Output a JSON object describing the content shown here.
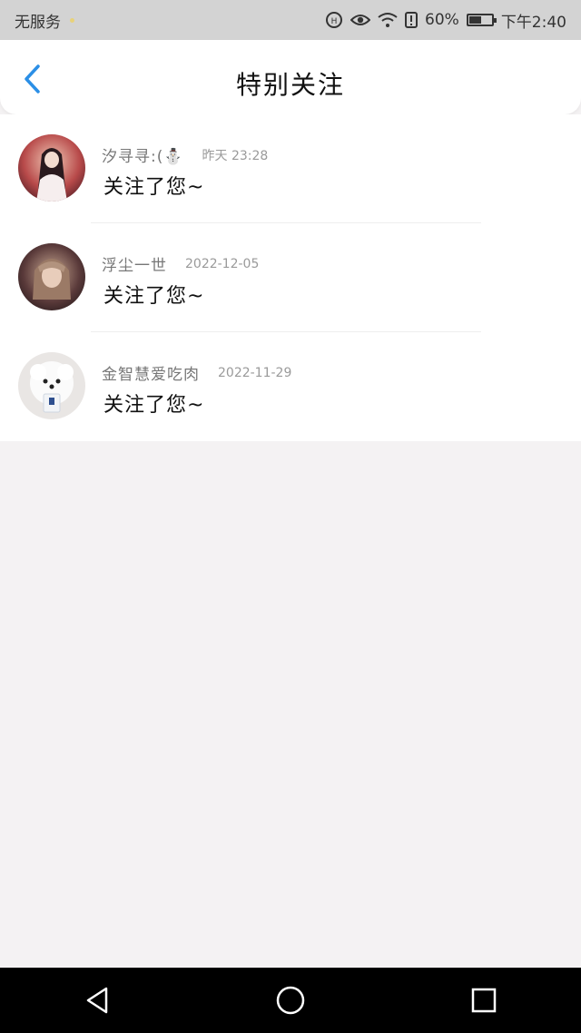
{
  "status_bar": {
    "carrier": "无服务",
    "battery": "60%",
    "battery_level": 0.6,
    "time": "下午2:40"
  },
  "header": {
    "title": "特别关注",
    "back_icon": "chevron-left-icon",
    "accent_color": "#2b8fe6"
  },
  "items": [
    {
      "name": "汐寻寻:(⛄",
      "time": "昨天 23:28",
      "message": "关注了您~"
    },
    {
      "name": "浮尘一世",
      "time": "2022-12-05",
      "message": "关注了您~"
    },
    {
      "name": "金智慧爱吃肉",
      "time": "2022-11-29",
      "message": "关注了您~"
    }
  ],
  "nav": {
    "back": "triangle-back-icon",
    "home": "circle-home-icon",
    "recent": "square-recent-icon"
  }
}
